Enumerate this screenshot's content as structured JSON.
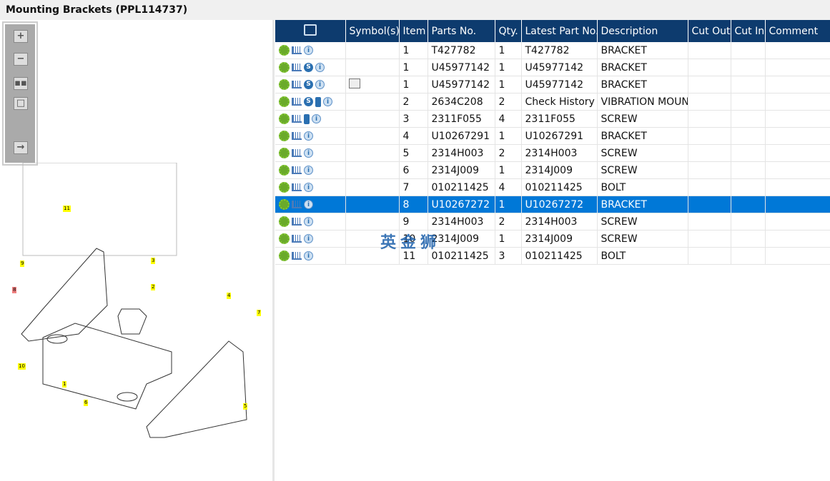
{
  "title": "Mounting Brackets (PPL114737)",
  "toolbar": [
    "zoom-in",
    "zoom-out",
    "fit-all",
    "fit-window",
    "toggle-panel"
  ],
  "table": {
    "headers": [
      "",
      "Symbol(s)",
      "Item",
      "Parts No.",
      "Qty.",
      "Latest Part No.",
      "Description",
      "Cut Out",
      "Cut In",
      "Comment"
    ],
    "rows": [
      {
        "icons": [
          "gear",
          "cart",
          "info"
        ],
        "symbol": "",
        "item": "1",
        "part": "T427782",
        "qty": "1",
        "latest": "T427782",
        "desc": "BRACKET"
      },
      {
        "icons": [
          "gear",
          "cart",
          "s",
          "info"
        ],
        "symbol": "",
        "item": "1",
        "part": "U45977142",
        "qty": "1",
        "latest": "U45977142",
        "desc": "BRACKET"
      },
      {
        "icons": [
          "gear",
          "cart",
          "s",
          "info"
        ],
        "symbol": "magnifier-book",
        "item": "1",
        "part": "U45977142",
        "qty": "1",
        "latest": "U45977142",
        "desc": "BRACKET"
      },
      {
        "icons": [
          "gear",
          "cart",
          "s",
          "book",
          "info"
        ],
        "symbol": "",
        "item": "2",
        "part": "2634C208",
        "qty": "2",
        "latest": "Check History",
        "desc": "VIBRATION MOUNT"
      },
      {
        "icons": [
          "gear",
          "cart",
          "book",
          "info"
        ],
        "symbol": "",
        "item": "3",
        "part": "2311F055",
        "qty": "4",
        "latest": "2311F055",
        "desc": "SCREW"
      },
      {
        "icons": [
          "gear",
          "cart",
          "info"
        ],
        "symbol": "",
        "item": "4",
        "part": "U10267291",
        "qty": "1",
        "latest": "U10267291",
        "desc": "BRACKET"
      },
      {
        "icons": [
          "gear",
          "cart",
          "info"
        ],
        "symbol": "",
        "item": "5",
        "part": "2314H003",
        "qty": "2",
        "latest": "2314H003",
        "desc": "SCREW"
      },
      {
        "icons": [
          "gear",
          "cart",
          "info"
        ],
        "symbol": "",
        "item": "6",
        "part": "2314J009",
        "qty": "1",
        "latest": "2314J009",
        "desc": "SCREW"
      },
      {
        "icons": [
          "gear",
          "cart",
          "info"
        ],
        "symbol": "",
        "item": "7",
        "part": "010211425",
        "qty": "4",
        "latest": "010211425",
        "desc": "BOLT"
      },
      {
        "icons": [
          "gear",
          "cart",
          "info"
        ],
        "symbol": "",
        "item": "8",
        "part": "U10267272",
        "qty": "1",
        "latest": "U10267272",
        "desc": "BRACKET",
        "selected": true
      },
      {
        "icons": [
          "gear",
          "cart",
          "info"
        ],
        "symbol": "",
        "item": "9",
        "part": "2314H003",
        "qty": "2",
        "latest": "2314H003",
        "desc": "SCREW"
      },
      {
        "icons": [
          "gear",
          "cart",
          "info"
        ],
        "symbol": "",
        "item": "10",
        "part": "2314J009",
        "qty": "1",
        "latest": "2314J009",
        "desc": "SCREW"
      },
      {
        "icons": [
          "gear",
          "cart",
          "info"
        ],
        "symbol": "",
        "item": "11",
        "part": "010211425",
        "qty": "3",
        "latest": "010211425",
        "desc": "BOLT"
      }
    ]
  },
  "callouts": [
    "11",
    "9",
    "8",
    "3",
    "2",
    "4",
    "7",
    "10",
    "1",
    "6",
    "5"
  ],
  "watermark": "英金狮",
  "colors": {
    "header": "#0d3b6e",
    "selected": "#0078d7",
    "callout": "#ffff00"
  }
}
